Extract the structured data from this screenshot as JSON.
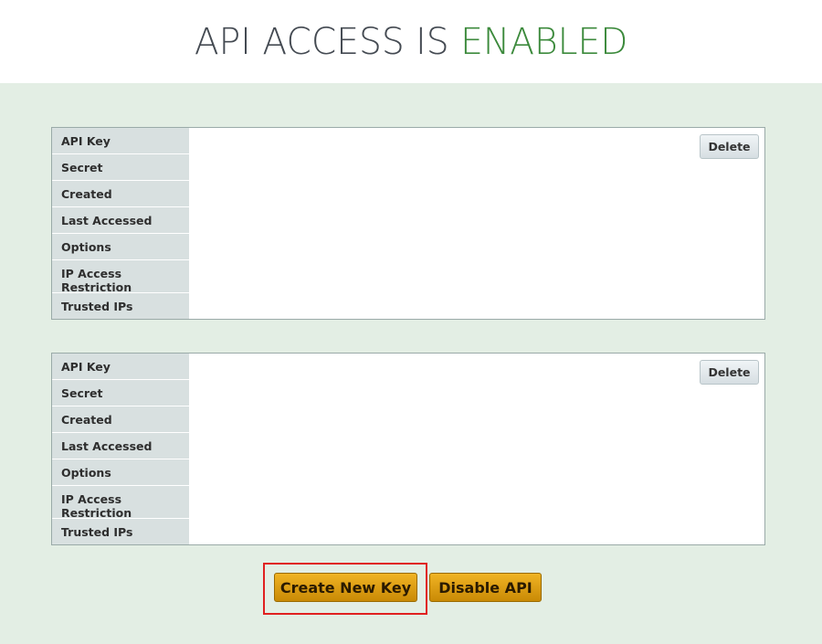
{
  "header": {
    "title_prefix": "API ACCESS IS",
    "title_status": "ENABLED",
    "status_color": "#3c8a3c"
  },
  "keys": [
    {
      "labels": [
        "API Key",
        "Secret",
        "Created",
        "Last Accessed",
        "Options",
        "IP Access Restriction",
        "Trusted IPs"
      ],
      "delete_label": "Delete"
    },
    {
      "labels": [
        "API Key",
        "Secret",
        "Created",
        "Last Accessed",
        "Options",
        "IP Access Restriction",
        "Trusted IPs"
      ],
      "delete_label": "Delete"
    }
  ],
  "actions": {
    "create_label": "Create New Key",
    "disable_label": "Disable API"
  }
}
